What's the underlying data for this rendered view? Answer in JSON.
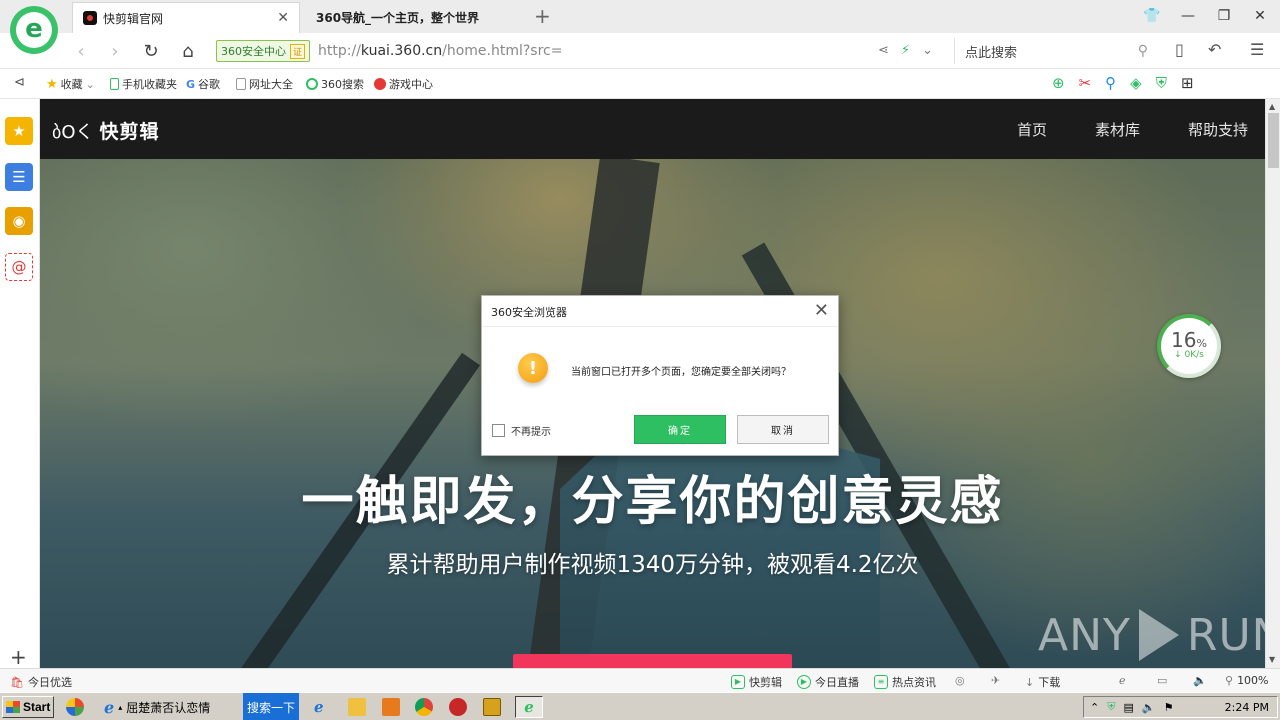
{
  "browser": {
    "tabs": [
      {
        "label": "快剪辑官网"
      },
      {
        "label": "360导航_一个主页，整个世界"
      }
    ],
    "security_badge": "360安全中心",
    "cert_badge": "证",
    "url_dim": "http://",
    "url_host": "kuai.360.cn",
    "url_path": "/home.html?src=",
    "search_placeholder": "点此搜索",
    "bookmarks": [
      {
        "label": "收藏",
        "icon": "star-icon",
        "color": "#f5b400"
      },
      {
        "label": "手机收藏夹",
        "icon": "phone-icon",
        "color": "#2fbf63"
      },
      {
        "label": "谷歌",
        "icon": "google-icon",
        "color": "#4285f4"
      },
      {
        "label": "网址大全",
        "icon": "page-icon",
        "color": "#9e9e9e"
      },
      {
        "label": "360搜索",
        "icon": "so360-icon",
        "color": "#2fbf63"
      },
      {
        "label": "游戏中心",
        "icon": "game-icon",
        "color": "#e53935"
      }
    ]
  },
  "site": {
    "logo_mark": "ბOく",
    "logo_text": "快剪辑",
    "nav": [
      "首页",
      "素材库",
      "帮助支持"
    ],
    "hero_title": "一触即发，分享你的创意灵感",
    "hero_subtitle": "累计帮助用户制作视频1340万分钟，被观看4.2亿次"
  },
  "speed_widget": {
    "percent": "16",
    "percent_sign": "%",
    "rate": "0K/s"
  },
  "watermark": {
    "left": "ANY",
    "right": "RUN"
  },
  "dialog": {
    "title": "360安全浏览器",
    "message": "当前窗口已打开多个页面，您确定要全部关闭吗？",
    "checkbox_label": "不再提示",
    "ok_label": "确定",
    "cancel_label": "取消"
  },
  "statusbar": {
    "left_label": "今日优选",
    "items": [
      "快剪辑",
      "今日直播",
      "热点资讯"
    ],
    "download": "下载",
    "zoom": "100%"
  },
  "taskbar": {
    "start": "Start",
    "ie_window": "屈楚萧否认恋情",
    "search_button": "搜索一下",
    "clock": "2:24 PM"
  },
  "colors": {
    "accent_green": "#2fbf63",
    "hero_button": "#f2355b",
    "header_dark": "#1b1b1b"
  }
}
